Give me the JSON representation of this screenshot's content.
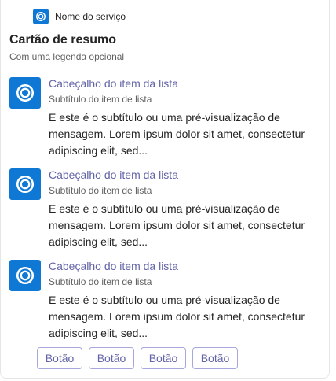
{
  "service": {
    "name": "Nome do serviço",
    "icon": "ring-logo-icon"
  },
  "card": {
    "title": "Cartão de resumo",
    "caption": "Com uma legenda opcional"
  },
  "items": [
    {
      "header": "Cabeçalho do item da lista",
      "subtitle": "Subtítulo do item de lista",
      "body": "E este é o subtítulo ou uma pré-visualização de mensagem. Lorem ipsum dolor sit amet, consectetur adipiscing elit, sed..."
    },
    {
      "header": "Cabeçalho do item da lista",
      "subtitle": "Subtítulo do item de lista",
      "body": "E este é o subtítulo ou uma pré-visualização de mensagem. Lorem ipsum dolor sit amet, consectetur adipiscing elit, sed..."
    },
    {
      "header": "Cabeçalho do item da lista",
      "subtitle": "Subtítulo do item de lista",
      "body": "E este é o subtítulo ou uma pré-visualização de mensagem. Lorem ipsum dolor sit amet, consectetur adipiscing elit, sed..."
    }
  ],
  "buttons": [
    "Botão",
    "Botão",
    "Botão",
    "Botão"
  ],
  "colors": {
    "accent": "#6264a7",
    "brand": "#0f78d4"
  }
}
